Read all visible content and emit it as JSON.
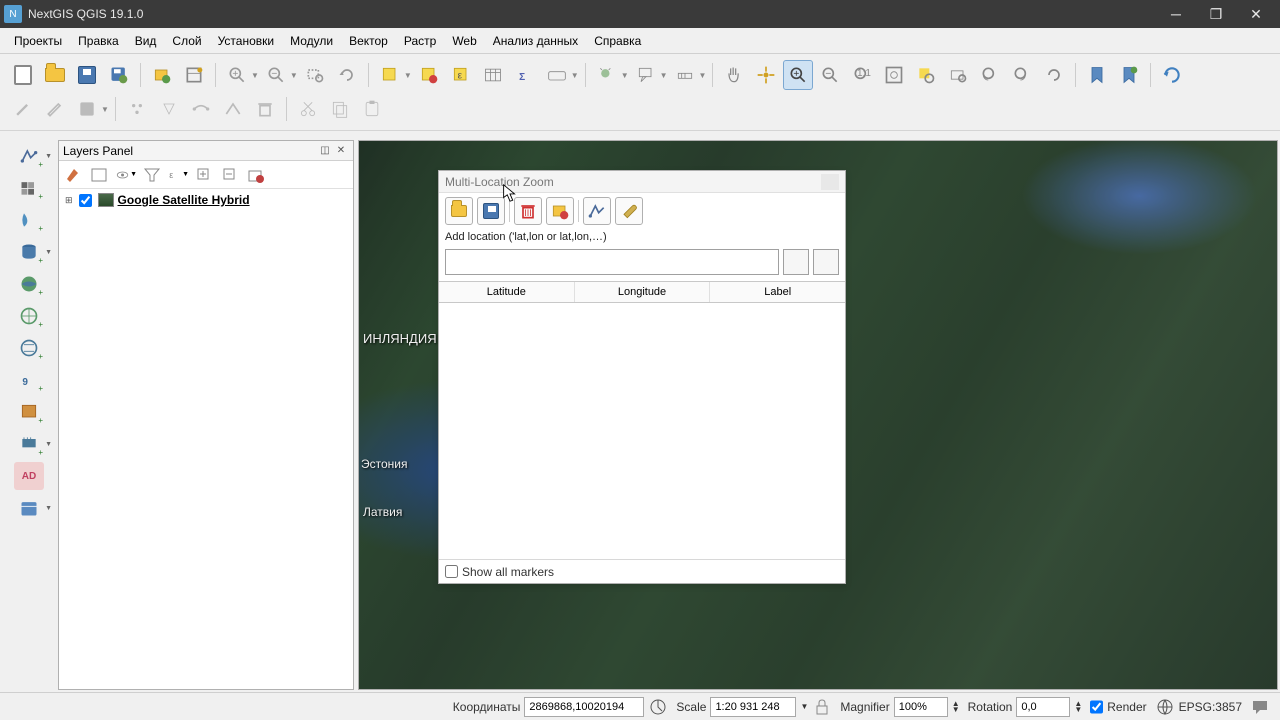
{
  "window": {
    "title": "NextGIS QGIS 19.1.0"
  },
  "menu": [
    "Проекты",
    "Правка",
    "Вид",
    "Слой",
    "Установки",
    "Модули",
    "Вектор",
    "Растр",
    "Web",
    "Анализ данных",
    "Справка"
  ],
  "layers_panel": {
    "title": "Layers Panel",
    "items": [
      {
        "name": "Google Satellite Hybrid",
        "checked": true
      }
    ]
  },
  "mlz": {
    "title": "Multi-Location Zoom",
    "add_label": "Add location ('lat,lon or lat,lon,…)",
    "cols": [
      "Latitude",
      "Longitude",
      "Label"
    ],
    "footer": "Show all markers"
  },
  "map_labels": {
    "finland": "ИНЛЯНДИЯ",
    "estonia": "Эстония",
    "latvia": "Латвия"
  },
  "statusbar": {
    "coords_label": "Координаты",
    "coords_value": "2869868,10020194",
    "scale_label": "Scale",
    "scale_value": "1:20 931 248",
    "magnifier_label": "Magnifier",
    "magnifier_value": "100%",
    "rotation_label": "Rotation",
    "rotation_value": "0,0",
    "render_label": "Render",
    "crs": "EPSG:3857"
  }
}
